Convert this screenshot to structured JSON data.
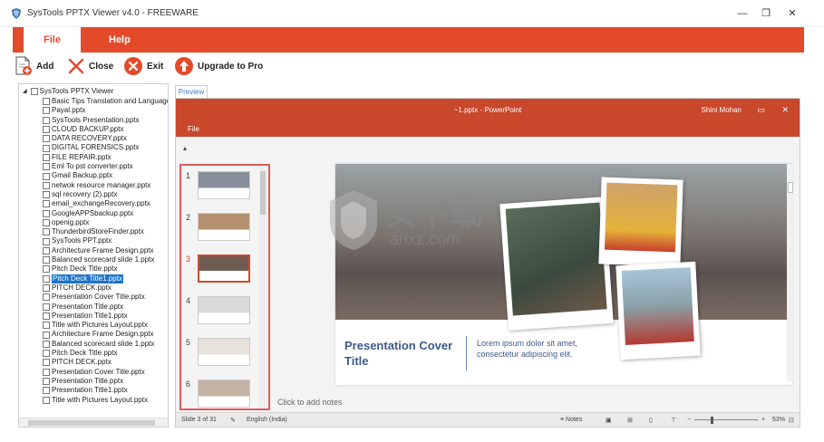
{
  "window": {
    "title": "SysTools PPTX Viewer v4.0 - FREEWARE",
    "minimize": "—",
    "maximize": "❐",
    "close": "✕"
  },
  "ribbon": {
    "tabs": [
      {
        "label": "File",
        "active": true
      },
      {
        "label": "Help",
        "active": false
      }
    ]
  },
  "toolbar": {
    "add": "Add",
    "close": "Close",
    "exit": "Exit",
    "upgrade": "Upgrade to Pro"
  },
  "tree": {
    "root": "SysTools PPTX Viewer",
    "items": [
      "Basic Tips Translation and Language Ger",
      "Payal.pptx",
      "SysTools Presentation.pptx",
      "CLOUD BACKUP.pptx",
      "DATA RECOVERY.pptx",
      "DIGITAL FORENSICS.pptx",
      "FILE REPAIR.pptx",
      "Eml To pst converter.pptx",
      "Gmail Backup.pptx",
      "netwok resource manager.pptx",
      "sql recovery (2).pptx",
      "email_exchangeRecovery.pptx",
      "GoogleAPPSbackup.pptx",
      "openig.pptx",
      "ThunderbirdStoreFinder.pptx",
      "SysTools PPT.pptx",
      "Architecture Frame Design.pptx",
      "Balanced scorecard slide 1.pptx",
      "Pitch Deck Title.pptx",
      "Pitch Deck Title1.pptx",
      "PITCH DECK.pptx",
      "Presentation Cover Title.pptx",
      "Presentation Title.pptx",
      "Presentation Title1.pptx",
      "Title with Pictures Layout.pptx",
      "Architecture Frame Design.pptx",
      "Balanced scorecard slide 1.pptx",
      "Pitch Deck Title.pptx",
      "PITCH DECK.pptx",
      "Presentation Cover Title.pptx",
      "Presentation Title.pptx",
      "Presentation Title1.pptx",
      "Title with Pictures Layout.pptx"
    ],
    "selected_index": 19
  },
  "preview": {
    "tab_label": "Preview",
    "app_title": "~1.pptx  -  PowerPoint",
    "user": "Shini Mohan",
    "file_menu": "File",
    "collapse_arrow": "▴",
    "thumbnails": [
      {
        "number": "1",
        "active": false
      },
      {
        "number": "2",
        "active": false
      },
      {
        "number": "3",
        "active": true
      },
      {
        "number": "4",
        "active": false
      },
      {
        "number": "5",
        "active": false
      },
      {
        "number": "6",
        "active": false
      }
    ],
    "slide": {
      "title": "Presentation Cover Title",
      "body": "Lorem ipsum dolor sit amet, consectetur adipiscing elit."
    },
    "notes_placeholder": "Click to add notes",
    "status": {
      "slide_info": "Slide 3 of 31",
      "language": "English (India)",
      "notes": "Notes",
      "zoom": "53%"
    }
  },
  "watermark": {
    "text": "安下载",
    "url": "anxz.com"
  },
  "colors": {
    "accent": "#e34a2a",
    "powerpoint_red": "#c9472b",
    "slide_text": "#3d5a8a"
  }
}
